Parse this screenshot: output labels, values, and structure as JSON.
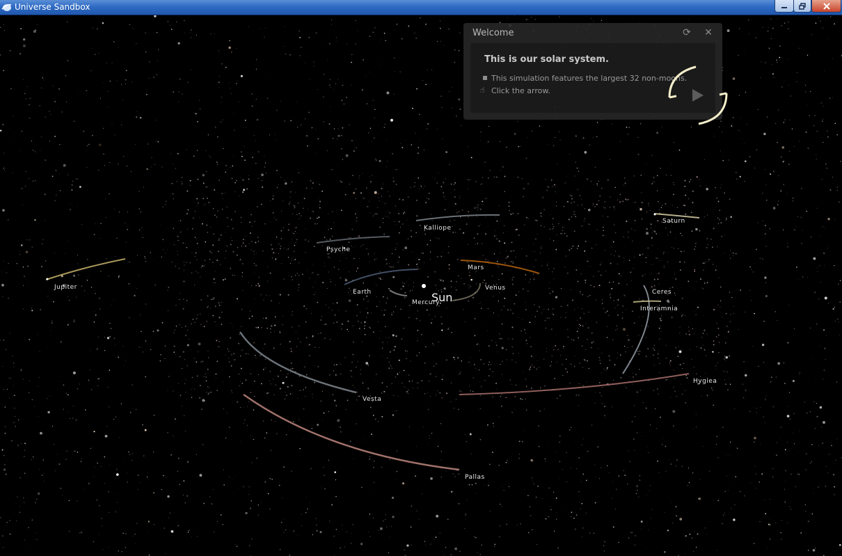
{
  "window": {
    "title": "Universe Sandbox",
    "minimize_icon": "minimize-icon",
    "maximize_icon": "restore-icon",
    "close_icon": "close-icon"
  },
  "welcome": {
    "title": "Welcome",
    "heading": "This is our solar system.",
    "bullets": [
      "This simulation features the largest 32 non-moons.",
      "Click the arrow."
    ],
    "refresh_icon": "refresh-icon",
    "close_icon": "close-icon",
    "next_icon": "play-arrow-icon"
  },
  "bodies": {
    "sun": "Sun",
    "mercury": "Mercury",
    "venus": "Venus",
    "earth": "Earth",
    "mars": "Mars",
    "jupiter": "Jupiter",
    "saturn": "Saturn",
    "ceres": "Ceres",
    "interamnia": "Interamnia",
    "hygiea": "Hygiea",
    "vesta": "Vesta",
    "pallas": "Pallas",
    "psyche": "Psyche",
    "kalliope": "Kalliope"
  },
  "colors": {
    "titlebar": "#2f6bc4",
    "background": "#000000",
    "panel": "#282828",
    "highlight_ring": "#f3eecb",
    "mars_orbit": "#b8650f",
    "jupiter_orbit": "#c7b36a",
    "pallas_orbit": "#c98e86",
    "hygiea_orbit": "#b37672"
  }
}
